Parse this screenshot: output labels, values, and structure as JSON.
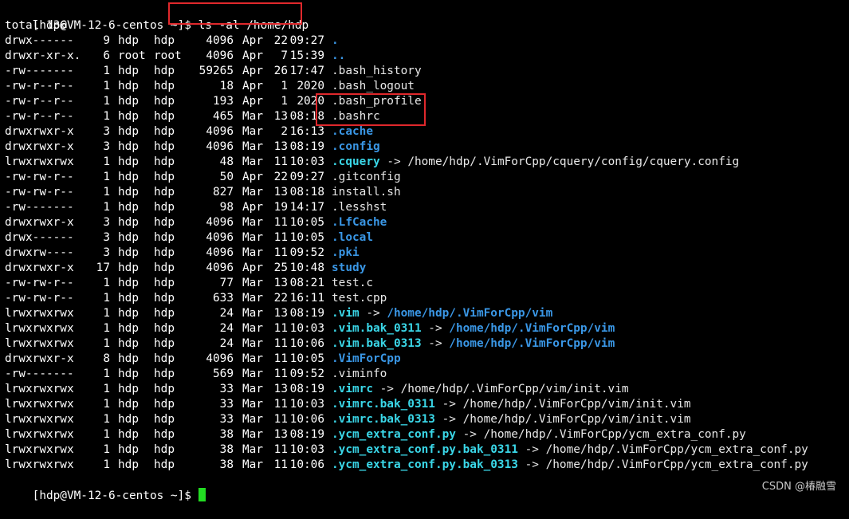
{
  "prompt": "[hdp@VM-12-6-centos ~]$",
  "command": " ls -al /home/hdp",
  "total": "total 136",
  "entries": [
    {
      "perm": "drwx------",
      "links": "9",
      "owner": "hdp",
      "group": "hdp",
      "size": "4096",
      "month": "Apr",
      "day": "22",
      "time": "09:27",
      "name": ".",
      "type": "dir"
    },
    {
      "perm": "drwxr-xr-x.",
      "links": "6",
      "owner": "root",
      "group": "root",
      "size": "4096",
      "month": "Apr",
      "day": "7",
      "time": "15:39",
      "name": "..",
      "type": "dir"
    },
    {
      "perm": "-rw-------",
      "links": "1",
      "owner": "hdp",
      "group": "hdp",
      "size": "59265",
      "month": "Apr",
      "day": "26",
      "time": "17:47",
      "name": ".bash_history",
      "type": "file"
    },
    {
      "perm": "-rw-r--r--",
      "links": "1",
      "owner": "hdp",
      "group": "hdp",
      "size": "18",
      "month": "Apr",
      "day": "1",
      "time": "2020",
      "name": ".bash_logout",
      "type": "file"
    },
    {
      "perm": "-rw-r--r--",
      "links": "1",
      "owner": "hdp",
      "group": "hdp",
      "size": "193",
      "month": "Apr",
      "day": "1",
      "time": "2020",
      "name": ".bash_profile",
      "type": "file"
    },
    {
      "perm": "-rw-r--r--",
      "links": "1",
      "owner": "hdp",
      "group": "hdp",
      "size": "465",
      "month": "Mar",
      "day": "13",
      "time": "08:18",
      "name": ".bashrc",
      "type": "file"
    },
    {
      "perm": "drwxrwxr-x",
      "links": "3",
      "owner": "hdp",
      "group": "hdp",
      "size": "4096",
      "month": "Mar",
      "day": "2",
      "time": "16:13",
      "name": ".cache",
      "type": "dir"
    },
    {
      "perm": "drwxrwxr-x",
      "links": "3",
      "owner": "hdp",
      "group": "hdp",
      "size": "4096",
      "month": "Mar",
      "day": "13",
      "time": "08:19",
      "name": ".config",
      "type": "dir"
    },
    {
      "perm": "lrwxrwxrwx",
      "links": "1",
      "owner": "hdp",
      "group": "hdp",
      "size": "48",
      "month": "Mar",
      "day": "11",
      "time": "10:03",
      "name": ".cquery",
      "type": "link",
      "target": "/home/hdp/.VimForCpp/cquery/config/cquery.config",
      "target_type": "file"
    },
    {
      "perm": "-rw-rw-r--",
      "links": "1",
      "owner": "hdp",
      "group": "hdp",
      "size": "50",
      "month": "Apr",
      "day": "22",
      "time": "09:27",
      "name": ".gitconfig",
      "type": "file"
    },
    {
      "perm": "-rw-rw-r--",
      "links": "1",
      "owner": "hdp",
      "group": "hdp",
      "size": "827",
      "month": "Mar",
      "day": "13",
      "time": "08:18",
      "name": "install.sh",
      "type": "file"
    },
    {
      "perm": "-rw-------",
      "links": "1",
      "owner": "hdp",
      "group": "hdp",
      "size": "98",
      "month": "Apr",
      "day": "19",
      "time": "14:17",
      "name": ".lesshst",
      "type": "file"
    },
    {
      "perm": "drwxrwxr-x",
      "links": "3",
      "owner": "hdp",
      "group": "hdp",
      "size": "4096",
      "month": "Mar",
      "day": "11",
      "time": "10:05",
      "name": ".LfCache",
      "type": "dir"
    },
    {
      "perm": "drwx------",
      "links": "3",
      "owner": "hdp",
      "group": "hdp",
      "size": "4096",
      "month": "Mar",
      "day": "11",
      "time": "10:05",
      "name": ".local",
      "type": "dir"
    },
    {
      "perm": "drwxrw----",
      "links": "3",
      "owner": "hdp",
      "group": "hdp",
      "size": "4096",
      "month": "Mar",
      "day": "11",
      "time": "09:52",
      "name": ".pki",
      "type": "dir"
    },
    {
      "perm": "drwxrwxr-x",
      "links": "17",
      "owner": "hdp",
      "group": "hdp",
      "size": "4096",
      "month": "Apr",
      "day": "25",
      "time": "10:48",
      "name": "study",
      "type": "dir"
    },
    {
      "perm": "-rw-rw-r--",
      "links": "1",
      "owner": "hdp",
      "group": "hdp",
      "size": "77",
      "month": "Mar",
      "day": "13",
      "time": "08:21",
      "name": "test.c",
      "type": "file"
    },
    {
      "perm": "-rw-rw-r--",
      "links": "1",
      "owner": "hdp",
      "group": "hdp",
      "size": "633",
      "month": "Mar",
      "day": "22",
      "time": "16:11",
      "name": "test.cpp",
      "type": "file"
    },
    {
      "perm": "lrwxrwxrwx",
      "links": "1",
      "owner": "hdp",
      "group": "hdp",
      "size": "24",
      "month": "Mar",
      "day": "13",
      "time": "08:19",
      "name": ".vim",
      "type": "link",
      "target": "/home/hdp/.VimForCpp/vim",
      "target_type": "dir"
    },
    {
      "perm": "lrwxrwxrwx",
      "links": "1",
      "owner": "hdp",
      "group": "hdp",
      "size": "24",
      "month": "Mar",
      "day": "11",
      "time": "10:03",
      "name": ".vim.bak_0311",
      "type": "link",
      "target": "/home/hdp/.VimForCpp/vim",
      "target_type": "dir"
    },
    {
      "perm": "lrwxrwxrwx",
      "links": "1",
      "owner": "hdp",
      "group": "hdp",
      "size": "24",
      "month": "Mar",
      "day": "11",
      "time": "10:06",
      "name": ".vim.bak_0313",
      "type": "link",
      "target": "/home/hdp/.VimForCpp/vim",
      "target_type": "dir"
    },
    {
      "perm": "drwxrwxr-x",
      "links": "8",
      "owner": "hdp",
      "group": "hdp",
      "size": "4096",
      "month": "Mar",
      "day": "11",
      "time": "10:05",
      "name": ".VimForCpp",
      "type": "dir"
    },
    {
      "perm": "-rw-------",
      "links": "1",
      "owner": "hdp",
      "group": "hdp",
      "size": "569",
      "month": "Mar",
      "day": "11",
      "time": "09:52",
      "name": ".viminfo",
      "type": "file"
    },
    {
      "perm": "lrwxrwxrwx",
      "links": "1",
      "owner": "hdp",
      "group": "hdp",
      "size": "33",
      "month": "Mar",
      "day": "13",
      "time": "08:19",
      "name": ".vimrc",
      "type": "link",
      "target": "/home/hdp/.VimForCpp/vim/init.vim",
      "target_type": "file"
    },
    {
      "perm": "lrwxrwxrwx",
      "links": "1",
      "owner": "hdp",
      "group": "hdp",
      "size": "33",
      "month": "Mar",
      "day": "11",
      "time": "10:03",
      "name": ".vimrc.bak_0311",
      "type": "link",
      "target": "/home/hdp/.VimForCpp/vim/init.vim",
      "target_type": "file"
    },
    {
      "perm": "lrwxrwxrwx",
      "links": "1",
      "owner": "hdp",
      "group": "hdp",
      "size": "33",
      "month": "Mar",
      "day": "11",
      "time": "10:06",
      "name": ".vimrc.bak_0313",
      "type": "link",
      "target": "/home/hdp/.VimForCpp/vim/init.vim",
      "target_type": "file"
    },
    {
      "perm": "lrwxrwxrwx",
      "links": "1",
      "owner": "hdp",
      "group": "hdp",
      "size": "38",
      "month": "Mar",
      "day": "13",
      "time": "08:19",
      "name": ".ycm_extra_conf.py",
      "type": "link",
      "target": "/home/hdp/.VimForCpp/ycm_extra_conf.py",
      "target_type": "file"
    },
    {
      "perm": "lrwxrwxrwx",
      "links": "1",
      "owner": "hdp",
      "group": "hdp",
      "size": "38",
      "month": "Mar",
      "day": "11",
      "time": "10:03",
      "name": ".ycm_extra_conf.py.bak_0311",
      "type": "link",
      "target": "/home/hdp/.VimForCpp/ycm_extra_conf.py",
      "target_type": "file"
    },
    {
      "perm": "lrwxrwxrwx",
      "links": "1",
      "owner": "hdp",
      "group": "hdp",
      "size": "38",
      "month": "Mar",
      "day": "11",
      "time": "10:06",
      "name": ".ycm_extra_conf.py.bak_0313",
      "type": "link",
      "target": "/home/hdp/.VimForCpp/ycm_extra_conf.py",
      "target_type": "file"
    }
  ],
  "arrow": " -> ",
  "watermark": "CSDN @椿融雪",
  "colors": {
    "dir": "#3a97e6",
    "link": "#3ad7e8",
    "cursor": "#22dd22",
    "highlight": "#e0282c"
  }
}
